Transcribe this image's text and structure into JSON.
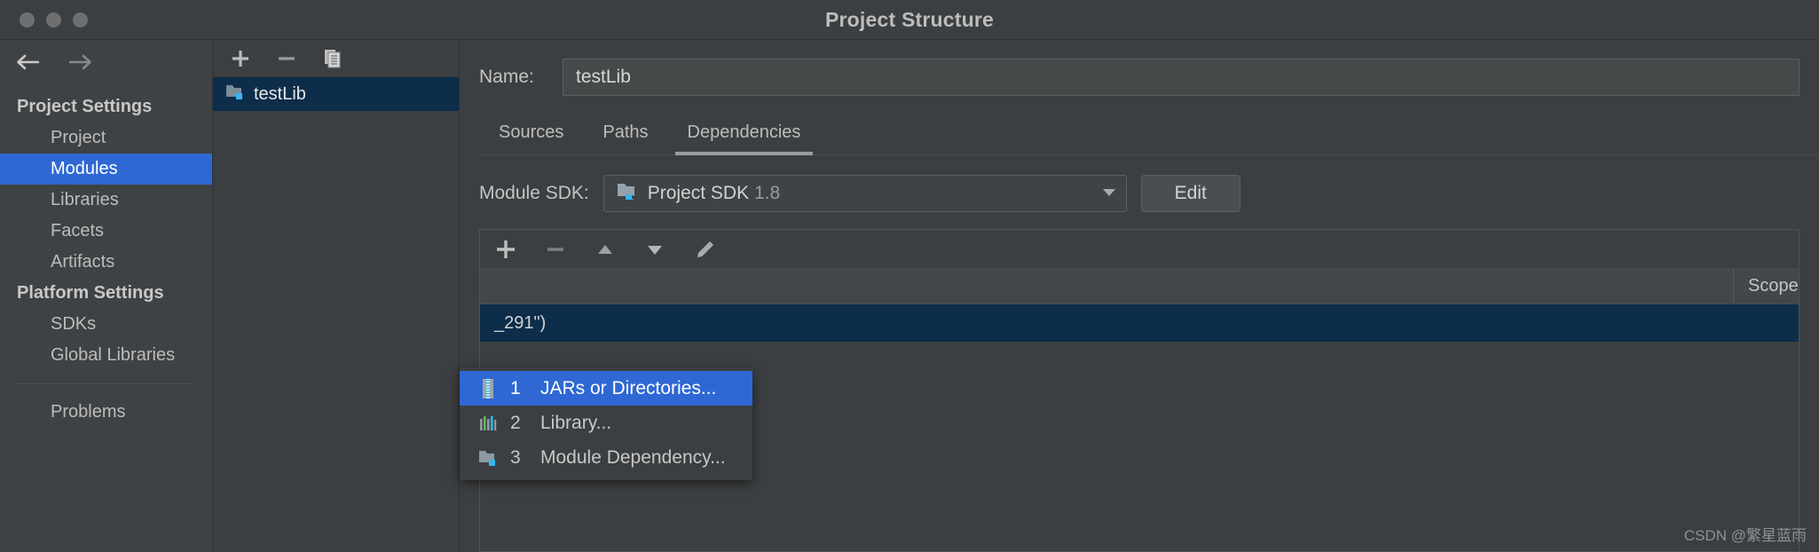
{
  "window": {
    "title": "Project Structure",
    "traffic_lights": [
      "close",
      "minimize",
      "maximize"
    ]
  },
  "sidebar": {
    "back_icon": "arrow-left-icon",
    "forward_icon": "arrow-right-icon",
    "groups": [
      {
        "label": "Project Settings",
        "items": [
          {
            "label": "Project",
            "selected": false
          },
          {
            "label": "Modules",
            "selected": true
          },
          {
            "label": "Libraries",
            "selected": false
          },
          {
            "label": "Facets",
            "selected": false
          },
          {
            "label": "Artifacts",
            "selected": false
          }
        ]
      },
      {
        "label": "Platform Settings",
        "items": [
          {
            "label": "SDKs",
            "selected": false
          },
          {
            "label": "Global Libraries",
            "selected": false
          }
        ]
      }
    ],
    "problems_label": "Problems"
  },
  "modules_panel": {
    "toolbar": [
      {
        "icon": "plus-icon",
        "name": "add-module-button"
      },
      {
        "icon": "minus-icon",
        "name": "remove-module-button"
      },
      {
        "icon": "copy-icon",
        "name": "copy-module-button"
      }
    ],
    "modules": [
      {
        "label": "testLib",
        "icon": "module-folder-icon",
        "selected": true
      }
    ]
  },
  "main": {
    "name_label": "Name:",
    "name_value": "testLib",
    "name_placeholder": "",
    "tabs": [
      {
        "label": "Sources",
        "active": false
      },
      {
        "label": "Paths",
        "active": false
      },
      {
        "label": "Dependencies",
        "active": true
      }
    ],
    "sdk_label": "Module SDK:",
    "sdk_value": "Project SDK",
    "sdk_version": "1.8",
    "sdk_icon": "java-sdk-icon",
    "sdk_dropdown_icon": "chevron-down-icon",
    "edit_button": "Edit",
    "deps_toolbar": [
      {
        "icon": "plus-icon",
        "name": "add-dependency-button",
        "enabled": true
      },
      {
        "icon": "minus-icon",
        "name": "remove-dependency-button",
        "enabled": false
      },
      {
        "icon": "arrow-up-icon",
        "name": "move-up-button",
        "enabled": true
      },
      {
        "icon": "arrow-down-icon",
        "name": "move-down-button",
        "enabled": true
      },
      {
        "icon": "pencil-icon",
        "name": "edit-dependency-button",
        "enabled": true
      }
    ],
    "table": {
      "columns": [
        "",
        "Scope"
      ],
      "rows": [
        {
          "export": "_291\")",
          "scope": ""
        }
      ]
    }
  },
  "add_menu": {
    "items": [
      {
        "number": "1",
        "label": "JARs or Directories...",
        "icon": "jar-icon",
        "highlighted": true
      },
      {
        "number": "2",
        "label": "Library...",
        "icon": "library-icon",
        "highlighted": false
      },
      {
        "number": "3",
        "label": "Module Dependency...",
        "icon": "module-folder-icon",
        "highlighted": false
      }
    ]
  },
  "watermark": "CSDN @繁星蓝雨",
  "colors": {
    "accent": "#2f68d4",
    "row_selected": "#0d2d4b",
    "window_bg": "#3c3f41",
    "sidebar_bg": "#3f4244"
  }
}
